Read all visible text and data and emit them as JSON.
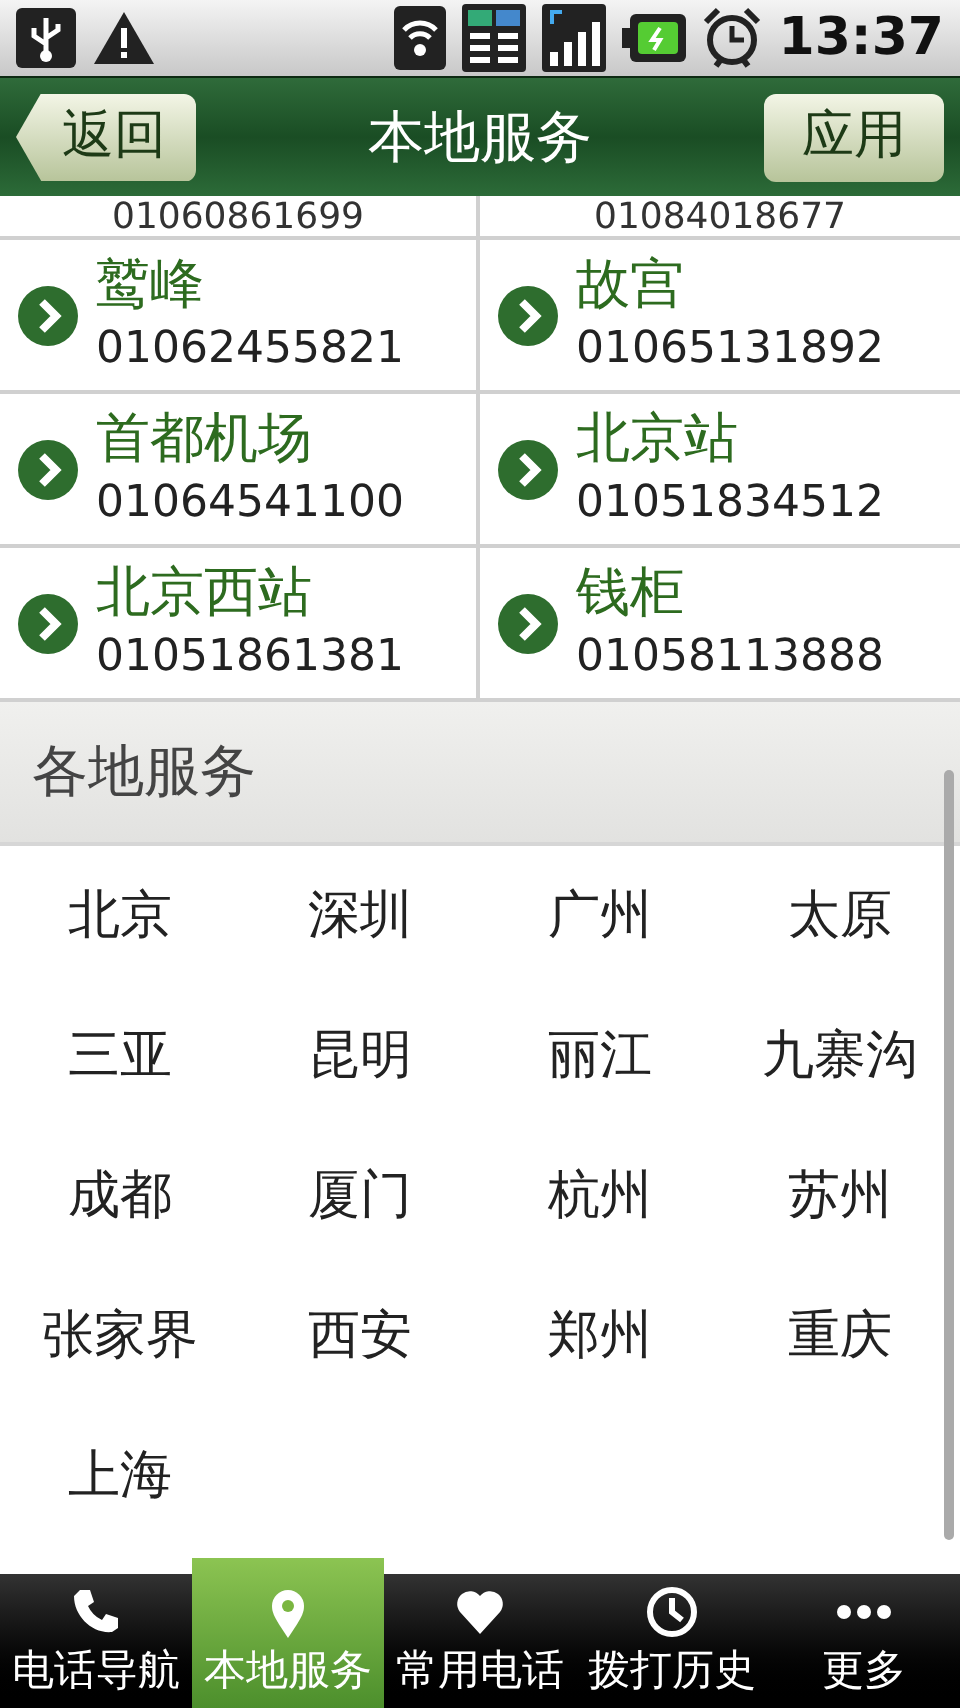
{
  "status_bar": {
    "time": "13:37"
  },
  "header": {
    "back": "返回",
    "title": "本地服务",
    "apply": "应用"
  },
  "partial_row": [
    "01060861699",
    "01084018677"
  ],
  "services": [
    {
      "name": "鹫峰",
      "phone": "01062455821"
    },
    {
      "name": "故宫",
      "phone": "01065131892"
    },
    {
      "name": "首都机场",
      "phone": "01064541100"
    },
    {
      "name": "北京站",
      "phone": "01051834512"
    },
    {
      "name": "北京西站",
      "phone": "01051861381"
    },
    {
      "name": "钱柜",
      "phone": "01058113888"
    }
  ],
  "section_title": "各地服务",
  "cities": [
    "北京",
    "深圳",
    "广州",
    "太原",
    "三亚",
    "昆明",
    "丽江",
    "九寨沟",
    "成都",
    "厦门",
    "杭州",
    "苏州",
    "张家界",
    "西安",
    "郑州",
    "重庆",
    "上海"
  ],
  "tabs": [
    {
      "label": "电话导航",
      "kind": "phone",
      "selected": false
    },
    {
      "label": "本地服务",
      "kind": "pin",
      "selected": true
    },
    {
      "label": "常用电话",
      "kind": "heart",
      "selected": false
    },
    {
      "label": "拨打历史",
      "kind": "clock",
      "selected": false
    },
    {
      "label": "更多",
      "kind": "more",
      "selected": false
    }
  ]
}
